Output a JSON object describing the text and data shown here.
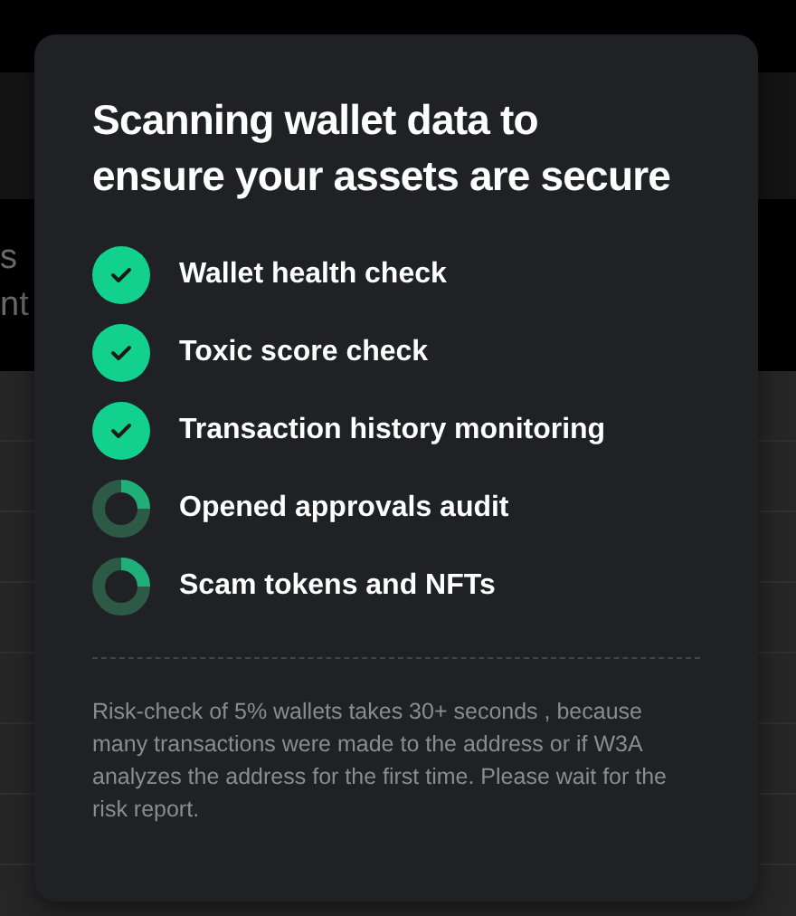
{
  "background": {
    "fragments": [
      "s",
      "nt"
    ]
  },
  "modal": {
    "title": "Scanning wallet data to ensure your assets are secure",
    "checks": [
      {
        "label": "Wallet health check",
        "done": true
      },
      {
        "label": "Toxic score check",
        "done": true
      },
      {
        "label": "Transaction history monitoring",
        "done": true
      },
      {
        "label": "Opened approvals audit",
        "done": false
      },
      {
        "label": "Scam tokens and NFTs",
        "done": false
      }
    ],
    "note": "Risk-check of 5% wallets takes 30+ seconds , because many transactions were made to the address or if W3A analyzes the address for the first time. Please wait for the risk report."
  }
}
